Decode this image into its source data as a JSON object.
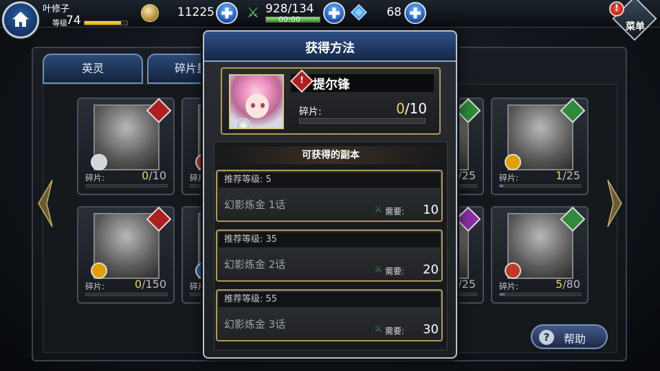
{
  "header": {
    "player_name": "叶修子",
    "level_label": "等级",
    "level": "74",
    "level_progress": 0.86,
    "coins": "11225",
    "stamina": "928/134",
    "stamina_timer": "00:00",
    "stamina_progress": 1.0,
    "gems": "68",
    "menu_label": "菜单",
    "alert_mark": "!"
  },
  "tabs": [
    {
      "label": "英灵"
    },
    {
      "label": "碎片量"
    }
  ],
  "grid": {
    "shard_label": "碎片:",
    "cards": [
      {
        "cur": "0",
        "max": "/10",
        "progress": 0,
        "elem_color": "#b01f1f",
        "badge_color": "#cfd6de"
      },
      {
        "cur": "",
        "max": "",
        "progress": 0,
        "elem_color": "#b01f1f",
        "badge_color": "#c0392b"
      },
      {
        "cur": "",
        "max": "/25",
        "progress": 0,
        "elem_color": "#2f8a3a",
        "badge_color": "#2f8a3a"
      },
      {
        "cur": "1",
        "max": "/25",
        "progress": 0.04,
        "elem_color": "#2f8a3a",
        "badge_color": "#e0a000"
      },
      {
        "cur": "0",
        "max": "/150",
        "progress": 0,
        "elem_color": "#b01f1f",
        "badge_color": "#e0a000"
      },
      {
        "cur": "",
        "max": "",
        "progress": 0,
        "elem_color": "#2a5fa8",
        "badge_color": "#2a5fa8"
      },
      {
        "cur": "",
        "max": "/25",
        "progress": 0,
        "elem_color": "#8a2fa8",
        "badge_color": "#8a2fa8"
      },
      {
        "cur": "5",
        "max": "/80",
        "progress": 0.06,
        "elem_color": "#2f8a3a",
        "badge_color": "#c0392b"
      }
    ]
  },
  "help_label": "帮助",
  "modal": {
    "title": "获得方法",
    "hero": {
      "alert_mark": "!",
      "name": "提尔锋",
      "shard_label": "碎片:",
      "shard_current": "0",
      "shard_max": "/10",
      "shard_progress": 0
    },
    "stages_title": "可获得的副本",
    "stages": [
      {
        "recommend": "推荐等级: 5",
        "name": "幻影炼金 1话",
        "cost_label": "需要:",
        "cost": "10"
      },
      {
        "recommend": "推荐等级: 35",
        "name": "幻影炼金 2话",
        "cost_label": "需要:",
        "cost": "20"
      },
      {
        "recommend": "推荐等级: 55",
        "name": "幻影炼金 3话",
        "cost_label": "需要:",
        "cost": "30"
      }
    ]
  }
}
